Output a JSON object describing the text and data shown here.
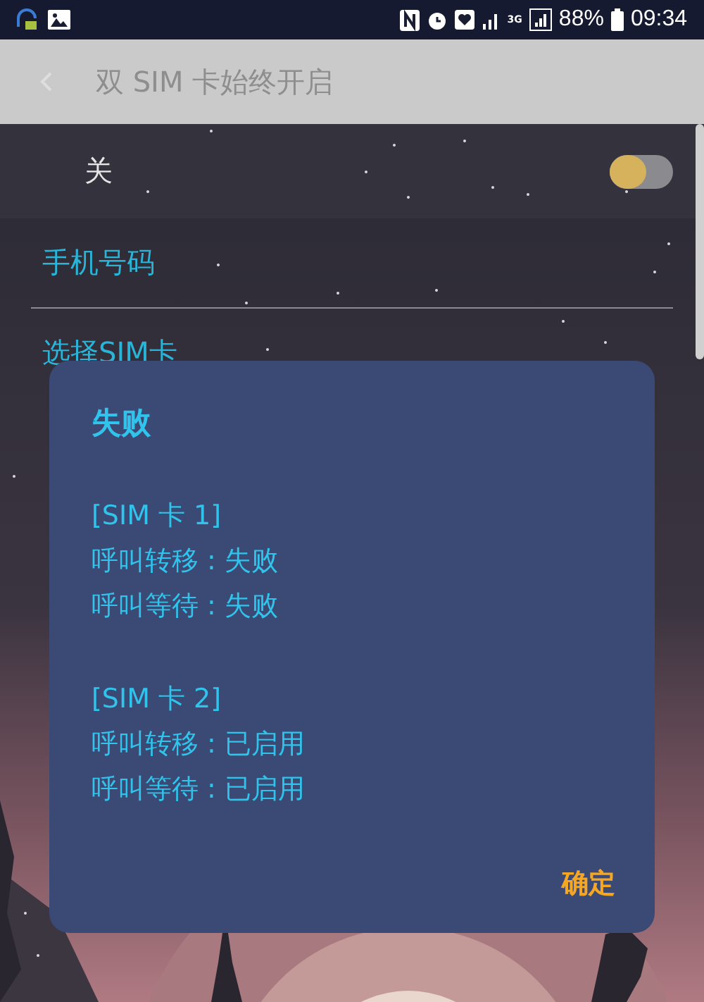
{
  "status_bar": {
    "battery": "88%",
    "network": "3G",
    "time": "09:34"
  },
  "header": {
    "title": "双 SIM 卡始终开启"
  },
  "master_switch": {
    "label": "关",
    "on": false
  },
  "list_items": [
    {
      "label": "手机号码"
    },
    {
      "label": "选择SIM卡"
    }
  ],
  "dialog": {
    "title": "失败",
    "sections": [
      {
        "heading": "[SIM 卡 1]",
        "lines": [
          "呼叫转移 : 失败",
          "呼叫等待 : 失败"
        ]
      },
      {
        "heading": "[SIM 卡 2]",
        "lines": [
          "呼叫转移 : 已启用",
          "呼叫等待 : 已启用"
        ]
      }
    ],
    "button": "确定"
  }
}
